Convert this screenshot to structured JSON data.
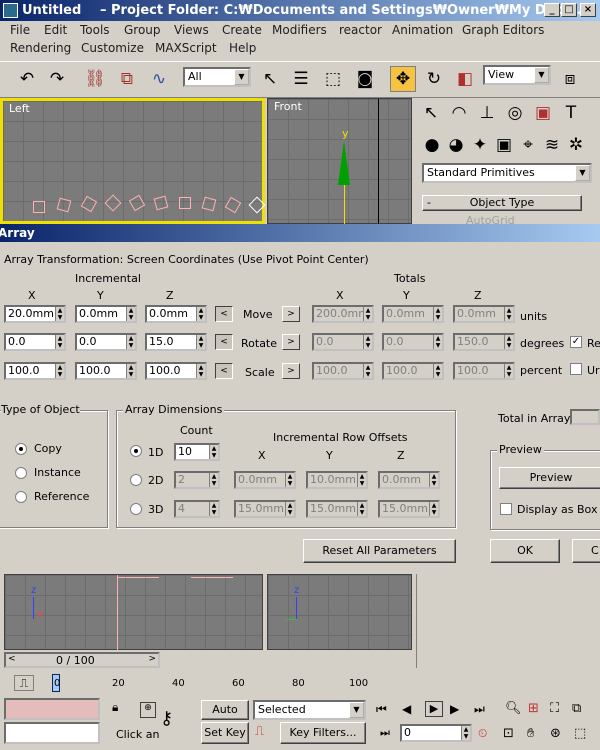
{
  "window": {
    "title": "Untitled",
    "subtitle": "– Project Folder: C:₩Documents and Settings₩Owner₩My Docu..."
  },
  "menu": [
    "File",
    "Edit",
    "Tools",
    "Group",
    "Views",
    "Create",
    "Modifiers",
    "reactor",
    "Animation",
    "Graph Editors",
    "Rendering",
    "Customize",
    "MAXScript",
    "Help"
  ],
  "toolbar": {
    "selection_filter": "All",
    "ref_coord": "View"
  },
  "viewports": {
    "left": "Left",
    "front": "Front",
    "axis_y": "y"
  },
  "command_panel": {
    "dropdown": "Standard Primitives",
    "rollout": "Object Type",
    "autogrid": "AutoGrid"
  },
  "dialog": {
    "title": "Array",
    "group_title": "Array Transformation: Screen Coordinates (Use Pivot Point Center)",
    "incremental": "Incremental",
    "totals": "Totals",
    "axes": [
      "X",
      "Y",
      "Z"
    ],
    "rows": [
      {
        "label": "Move",
        "inc": [
          "20.0mm",
          "0.0mm",
          "0.0mm"
        ],
        "tot": [
          "200.0mm",
          "0.0mm",
          "0.0mm"
        ],
        "unit": "units"
      },
      {
        "label": "Rotate",
        "inc": [
          "0.0",
          "0.0",
          "15.0"
        ],
        "tot": [
          "0.0",
          "0.0",
          "150.0"
        ],
        "unit": "degrees"
      },
      {
        "label": "Scale",
        "inc": [
          "100.0",
          "100.0",
          "100.0"
        ],
        "tot": [
          "100.0",
          "100.0",
          "100.0"
        ],
        "unit": "percent"
      }
    ],
    "re_label": "Re",
    "un_label": "Ur",
    "type_of_object": {
      "title": "Type of Object",
      "options": [
        "Copy",
        "Instance",
        "Reference"
      ]
    },
    "dims": {
      "title": "Array Dimensions",
      "count": "Count",
      "offsets": "Incremental Row Offsets",
      "rows": [
        {
          "label": "1D",
          "count": "10",
          "off": [
            "",
            "",
            ""
          ]
        },
        {
          "label": "2D",
          "count": "2",
          "off": [
            "0.0mm",
            "10.0mm",
            "0.0mm"
          ]
        },
        {
          "label": "3D",
          "count": "4",
          "off": [
            "15.0mm",
            "15.0mm",
            "15.0mm"
          ]
        }
      ]
    },
    "total_label": "Total in Array:",
    "preview_title": "Preview",
    "preview_btn": "Preview",
    "display_box": "Display as Box",
    "reset": "Reset All Parameters",
    "ok": "OK",
    "cancel": "C"
  },
  "bottom": {
    "frame": "0 / 100",
    "ticks": [
      "0",
      "20",
      "40",
      "60",
      "80",
      "100"
    ],
    "auto_key": "Auto Key",
    "set_key": "Set Key",
    "selected": "Selected",
    "key_filters": "Key Filters...",
    "click_an": "Click an",
    "frame_field": "0"
  }
}
